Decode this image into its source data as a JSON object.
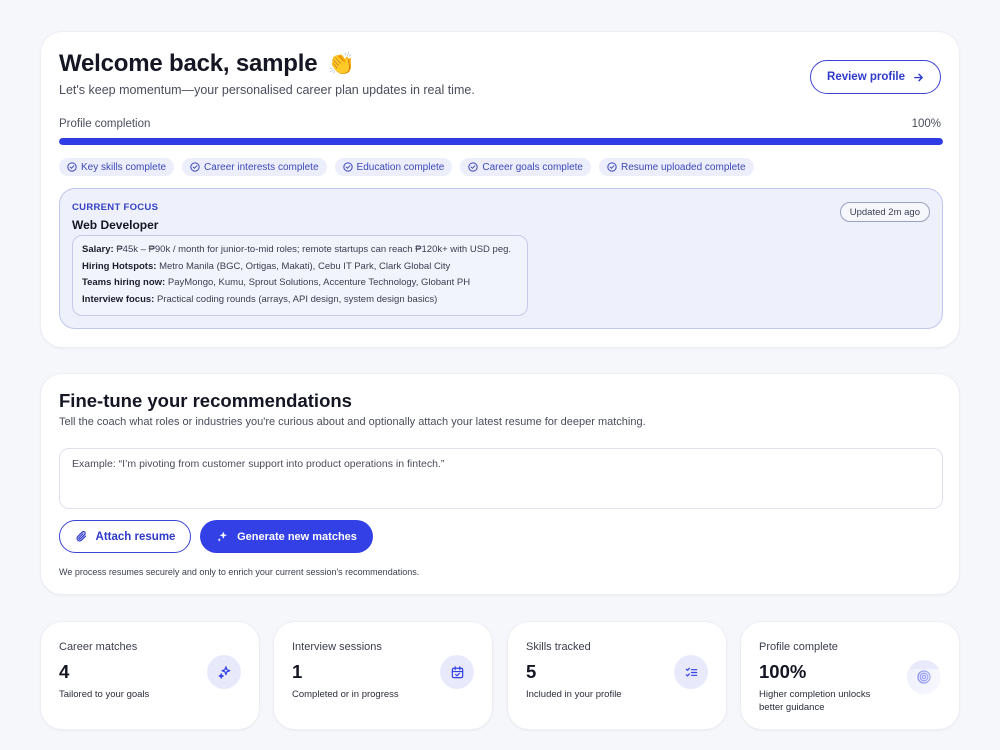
{
  "welcome": {
    "title": "Welcome back, sample",
    "emoji": "👏",
    "subtitle": "Let's keep momentum—your personalised career plan updates in real time.",
    "review_button": "Review profile",
    "progress_label": "Profile completion",
    "progress_value_text": "100%",
    "progress_fraction": 1.0,
    "chips": [
      "Key skills complete",
      "Career interests complete",
      "Education complete",
      "Career goals complete",
      "Resume uploaded complete"
    ]
  },
  "focus": {
    "kicker": "CURRENT FOCUS",
    "role": "Web Developer",
    "updated": "Updated 2m ago",
    "details": [
      {
        "label": "Salary:",
        "text": "₱45k – ₱90k / month for junior-to-mid roles; remote startups can reach ₱120k+ with USD peg."
      },
      {
        "label": "Hiring Hotspots:",
        "text": "Metro Manila (BGC, Ortigas, Makati), Cebu IT Park, Clark Global City"
      },
      {
        "label": "Teams hiring now:",
        "text": "PayMongo, Kumu, Sprout Solutions, Accenture Technology, Globant PH"
      },
      {
        "label": "Interview focus:",
        "text": "Practical coding rounds (arrays, API design, system design basics)"
      }
    ]
  },
  "finetune": {
    "title": "Fine-tune your recommendations",
    "subtitle": "Tell the coach what roles or industries you're curious about and optionally attach your latest resume for deeper matching.",
    "input_placeholder": "Example: “I’m pivoting from customer support into product operations in fintech.”",
    "attach_button": "Attach resume",
    "generate_button": "Generate new matches",
    "note": "We process resumes securely and only to enrich your current session's recommendations."
  },
  "stats": [
    {
      "label": "Career matches",
      "value": "4",
      "desc": "Tailored to your goals",
      "icon": "sparkles-icon"
    },
    {
      "label": "Interview sessions",
      "value": "1",
      "desc": "Completed or in progress",
      "icon": "calendar-check-icon"
    },
    {
      "label": "Skills tracked",
      "value": "5",
      "desc": "Included in your profile",
      "icon": "list-check-icon"
    },
    {
      "label": "Profile complete",
      "value": "100%",
      "desc": "Higher completion unlocks better guidance",
      "icon": "target-icon"
    }
  ],
  "colors": {
    "accent": "#3340e6",
    "chip_bg": "#eceefb",
    "focus_bg": "#eef0fc"
  }
}
